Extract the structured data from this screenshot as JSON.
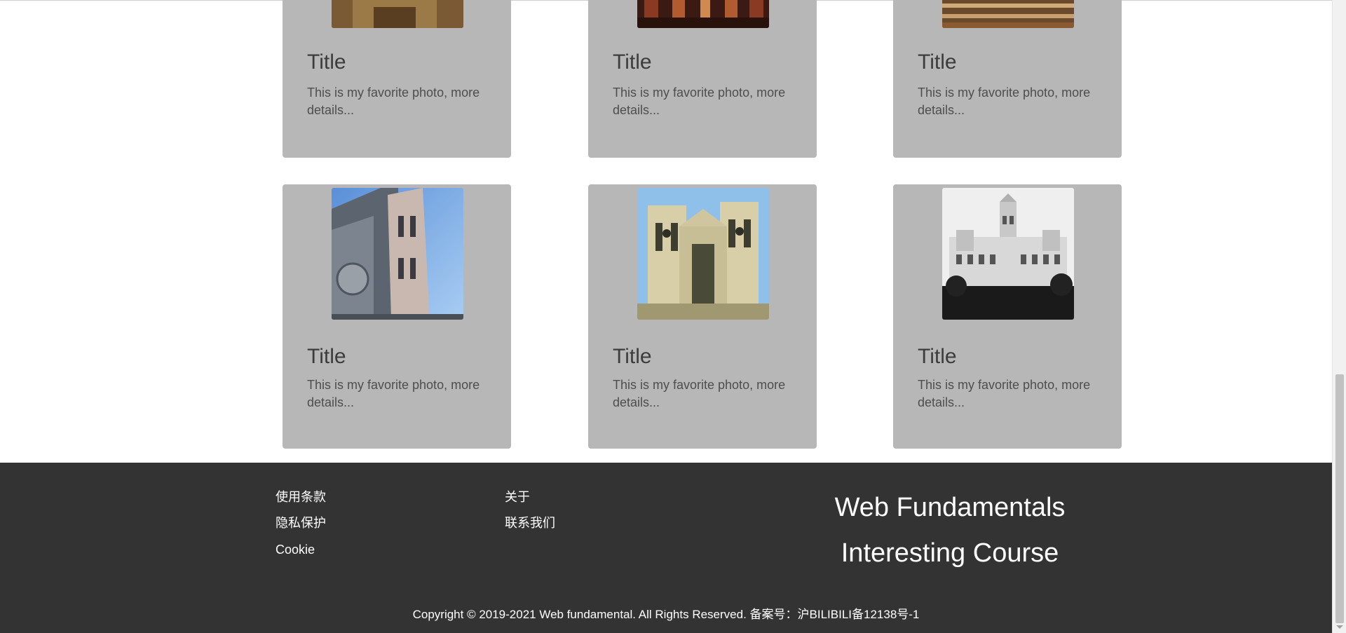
{
  "cards": [
    {
      "title": "Title",
      "desc": "This is my favorite photo, more details...",
      "image": "warm-interior-photo"
    },
    {
      "title": "Title",
      "desc": "This is my favorite photo, more details...",
      "image": "hall-interior-photo"
    },
    {
      "title": "Title",
      "desc": "This is my favorite photo, more details...",
      "image": "wooden-stairs-photo"
    },
    {
      "title": "Title",
      "desc": "This is my favorite photo, more details...",
      "image": "cathedral-tower-photo"
    },
    {
      "title": "Title",
      "desc": "This is my favorite photo, more details...",
      "image": "gothic-abbey-photo"
    },
    {
      "title": "Title",
      "desc": "This is my favorite photo, more details...",
      "image": "white-palace-photo"
    }
  ],
  "footer": {
    "links_col1": [
      "使用条款",
      "隐私保护",
      "Cookie"
    ],
    "links_col2": [
      "关于",
      "联系我们"
    ],
    "brand_line1": "Web Fundamentals",
    "brand_line2": "Interesting Course",
    "copyright": "Copyright © 2019-2021 Web fundamental. All Rights Reserved. 备案号：沪BILIBILI备12138号-1"
  },
  "colors": {
    "card_bg": "#b7b7b7",
    "footer_bg": "#333333",
    "text_dark": "#3c3c3c"
  }
}
